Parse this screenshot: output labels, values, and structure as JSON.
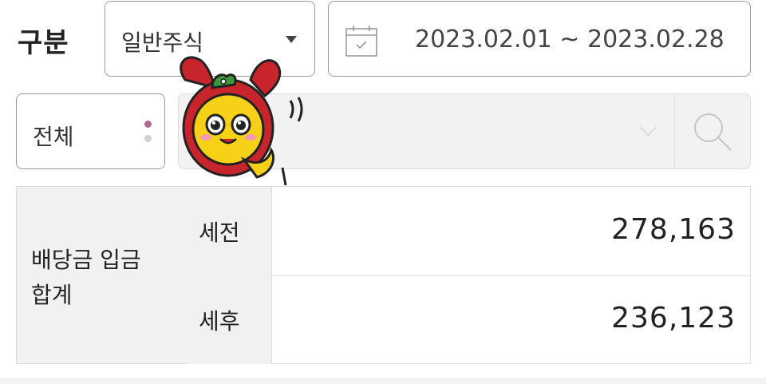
{
  "filter": {
    "gubun_label": "구분",
    "type_value": "일반주식",
    "date_range": "2023.02.01 ~ 2023.02.28",
    "scope_value": "전체"
  },
  "summary": {
    "title": "배당금 입금 합계",
    "rows": [
      {
        "label": "세전",
        "amount": "278,163"
      },
      {
        "label": "세후",
        "amount": "236,123"
      }
    ]
  },
  "colors": {
    "border": "#9a9a9a",
    "cell_bg": "#f1f1f1",
    "mascot_red": "#c8242b",
    "mascot_yellow": "#f7d117"
  },
  "icons": [
    "caret-down-icon",
    "calendar-icon",
    "chevron-down-icon",
    "search-icon",
    "mascot-sticker"
  ]
}
